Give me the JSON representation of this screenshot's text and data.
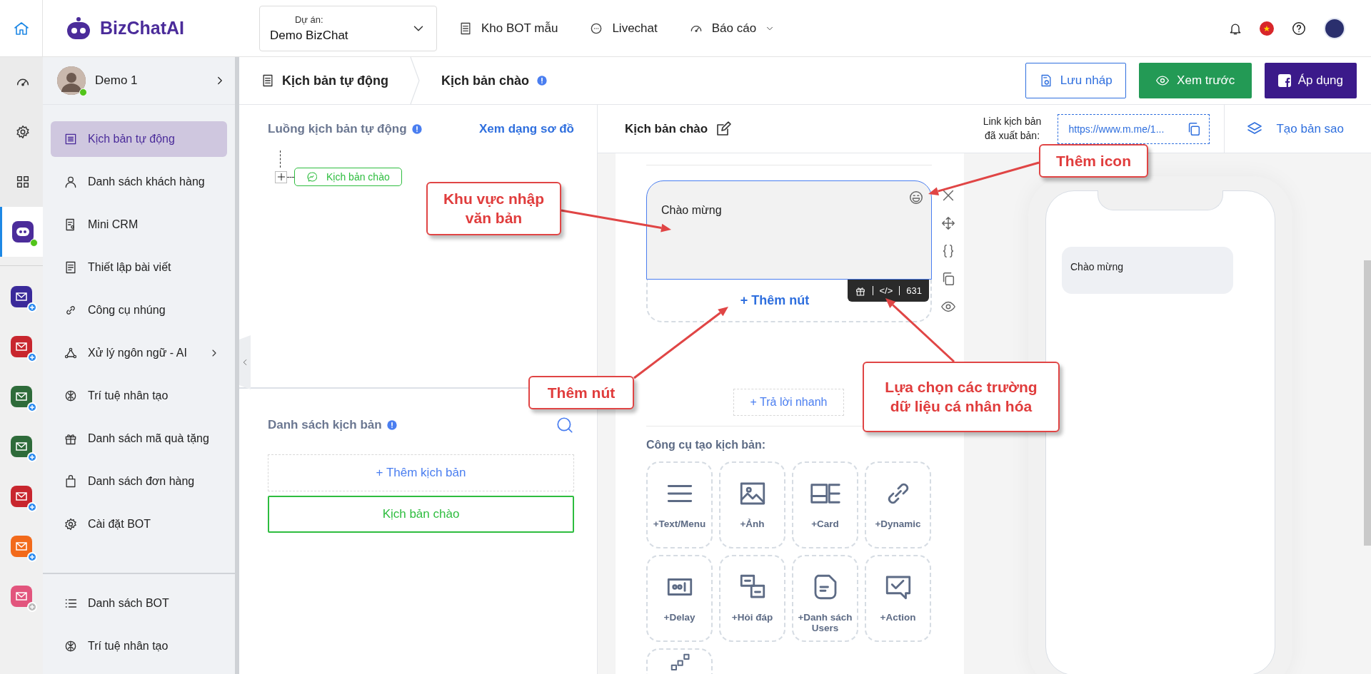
{
  "topbar": {
    "brand": "BizChatAI",
    "project": {
      "label": "Dự án:",
      "value": "Demo BizChat"
    },
    "nav": [
      {
        "label": "Kho BOT mẫu",
        "kind": "template",
        "dropdown": false
      },
      {
        "label": "Livechat",
        "kind": "chat",
        "dropdown": false
      },
      {
        "label": "Báo cáo",
        "kind": "gauge",
        "dropdown": true
      }
    ]
  },
  "rail": {
    "items": [
      {
        "kind": "gauge",
        "selected": false
      },
      {
        "kind": "gear",
        "selected": false
      },
      {
        "kind": "grid",
        "selected": false
      },
      {
        "kind": "bot",
        "selected": true
      }
    ],
    "apps": [
      {
        "color": "#3a2a9a",
        "disabled": false
      },
      {
        "color": "#c8262e",
        "disabled": false
      },
      {
        "color": "#2e6b3a",
        "disabled": false
      },
      {
        "color": "#2e6b3a",
        "disabled": false
      },
      {
        "color": "#c8262e",
        "disabled": false
      },
      {
        "color": "#f26a1b",
        "disabled": false
      },
      {
        "color": "#e2557d",
        "disabled": true
      }
    ]
  },
  "sidebar": {
    "profile": {
      "name": "Demo 1",
      "online": true
    },
    "items": [
      {
        "label": "Kịch bản tự động",
        "kind": "list",
        "selected": true,
        "submenu": false
      },
      {
        "label": "Danh sách khách hàng",
        "kind": "user",
        "selected": false,
        "submenu": false
      },
      {
        "label": "Mini CRM",
        "kind": "doc",
        "selected": false,
        "submenu": false
      },
      {
        "label": "Thiết lập bài viết",
        "kind": "page",
        "selected": false,
        "submenu": false
      },
      {
        "label": "Công cụ nhúng",
        "kind": "link",
        "selected": false,
        "submenu": false
      },
      {
        "label": "Xử lý ngôn ngữ - AI",
        "kind": "nodes",
        "selected": false,
        "submenu": true
      },
      {
        "label": "Trí tuệ nhân tạo",
        "kind": "ai",
        "selected": false,
        "submenu": false
      },
      {
        "label": "Danh sách mã quà tặng",
        "kind": "gift",
        "selected": false,
        "submenu": false
      },
      {
        "label": "Danh sách đơn hàng",
        "kind": "bag",
        "selected": false,
        "submenu": false
      },
      {
        "label": "Cài đặt BOT",
        "kind": "gear",
        "selected": false,
        "submenu": false
      }
    ],
    "bottom_items": [
      {
        "label": "Danh sách BOT",
        "kind": "bullets",
        "selected": false,
        "submenu": false
      },
      {
        "label": "Trí tuệ nhân tạo",
        "kind": "ai",
        "selected": false,
        "submenu": false
      }
    ]
  },
  "breadcrumb": [
    {
      "label": "Kịch bản tự động"
    },
    {
      "label": "Kịch bản chào"
    }
  ],
  "actions": [
    {
      "label": "Lưu nháp",
      "kind": "draft"
    },
    {
      "label": "Xem trước",
      "kind": "preview"
    },
    {
      "label": "Áp dụng",
      "kind": "apply"
    }
  ],
  "flow": {
    "title": "Luồng kịch bản tự động",
    "view_link": "Xem dạng sơ đồ",
    "nodes": [
      {
        "label": "Kịch bản chào"
      }
    ]
  },
  "scripts": {
    "title": "Danh sách kịch bản",
    "add": "+ Thêm kịch bản",
    "items": [
      {
        "label": "Kịch bản chào",
        "selected": true
      }
    ]
  },
  "editor": {
    "title": "Kịch bản chào",
    "link_label": "Link kịch bản đã xuất bản:",
    "link": "https://www.m.me/1...",
    "duplicate": "Tạo bản sao",
    "message": "Chào mừng",
    "add_button": "+ Thêm nút",
    "code_tag": "</>",
    "char_count": "631",
    "quick_reply": "+ Trả lời nhanh",
    "tools_title": "Công cụ tạo kịch bản:",
    "tools": [
      {
        "label": "+Text/Menu",
        "kind": "text"
      },
      {
        "label": "+Ảnh",
        "kind": "image"
      },
      {
        "label": "+Card",
        "kind": "card"
      },
      {
        "label": "+Dynamic",
        "kind": "dynamic"
      },
      {
        "label": "+Delay",
        "kind": "delay"
      },
      {
        "label": "+Hỏi đáp",
        "kind": "qa"
      },
      {
        "label": "+Danh sách Users",
        "kind": "users"
      },
      {
        "label": "+Action",
        "kind": "action"
      },
      {
        "kind": "flow"
      }
    ]
  },
  "preview": {
    "messages": [
      "Chào mừng"
    ]
  },
  "annotations": [
    {
      "text": "Khu vực nhập văn bản"
    },
    {
      "text": "Thêm icon"
    },
    {
      "text": "Thêm nút"
    },
    {
      "text": "Lựa chọn các trường dữ liệu cá nhân hóa"
    }
  ]
}
